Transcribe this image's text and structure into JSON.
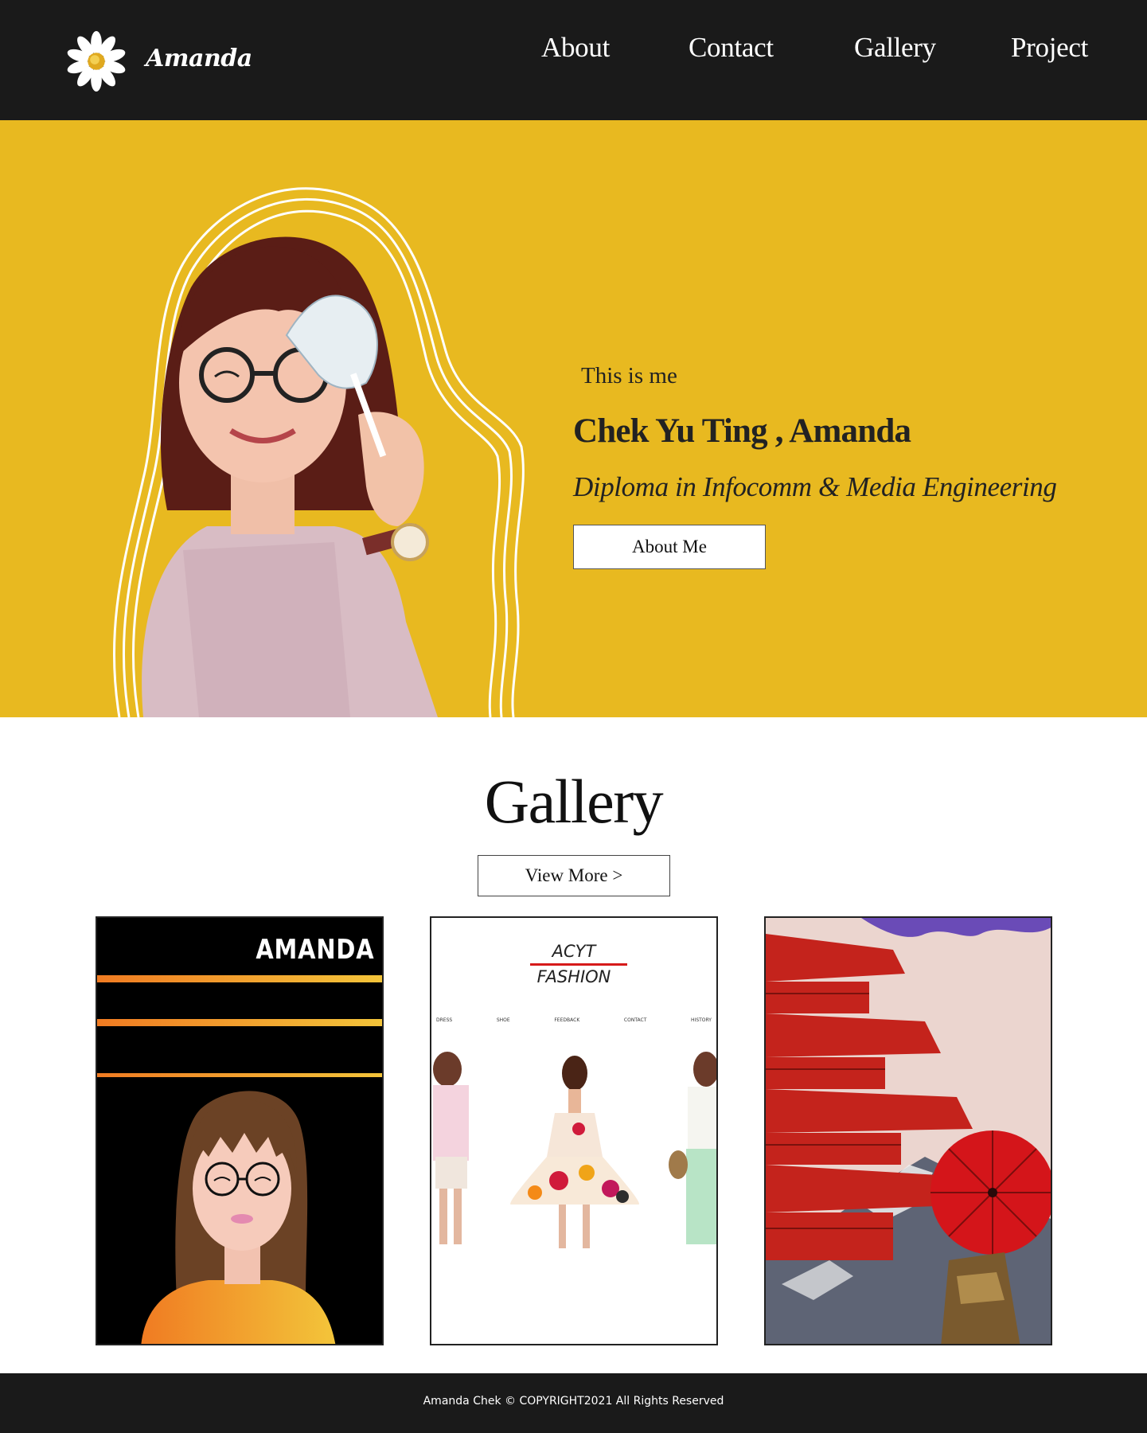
{
  "header": {
    "logo_text": "Amanda",
    "nav": {
      "about": "About",
      "contact": "Contact",
      "gallery": "Gallery",
      "project": "Project"
    }
  },
  "hero": {
    "intro": "This is me",
    "name": "Chek Yu Ting , Amanda",
    "subtitle": "Diploma in Infocomm & Media Engineering",
    "button_label": "About Me"
  },
  "gallery": {
    "title": "Gallery",
    "view_more_label": "View More >",
    "cards": [
      {
        "title": "AMANDA"
      },
      {
        "brand_line1": "ACYT",
        "brand_line2": "FASHION",
        "nav": [
          "DRESS",
          "SHOE",
          "FEEDBACK",
          "CONTACT",
          "HISTORY"
        ]
      },
      {}
    ]
  },
  "footer": {
    "copyright": "Amanda Chek © COPYRIGHT2021 All Rights Reserved"
  },
  "colors": {
    "header_bg": "#1a1a1a",
    "hero_bg": "#e8b920",
    "footer_bg": "#1a1a1a",
    "accent_red": "#d61a1a"
  }
}
